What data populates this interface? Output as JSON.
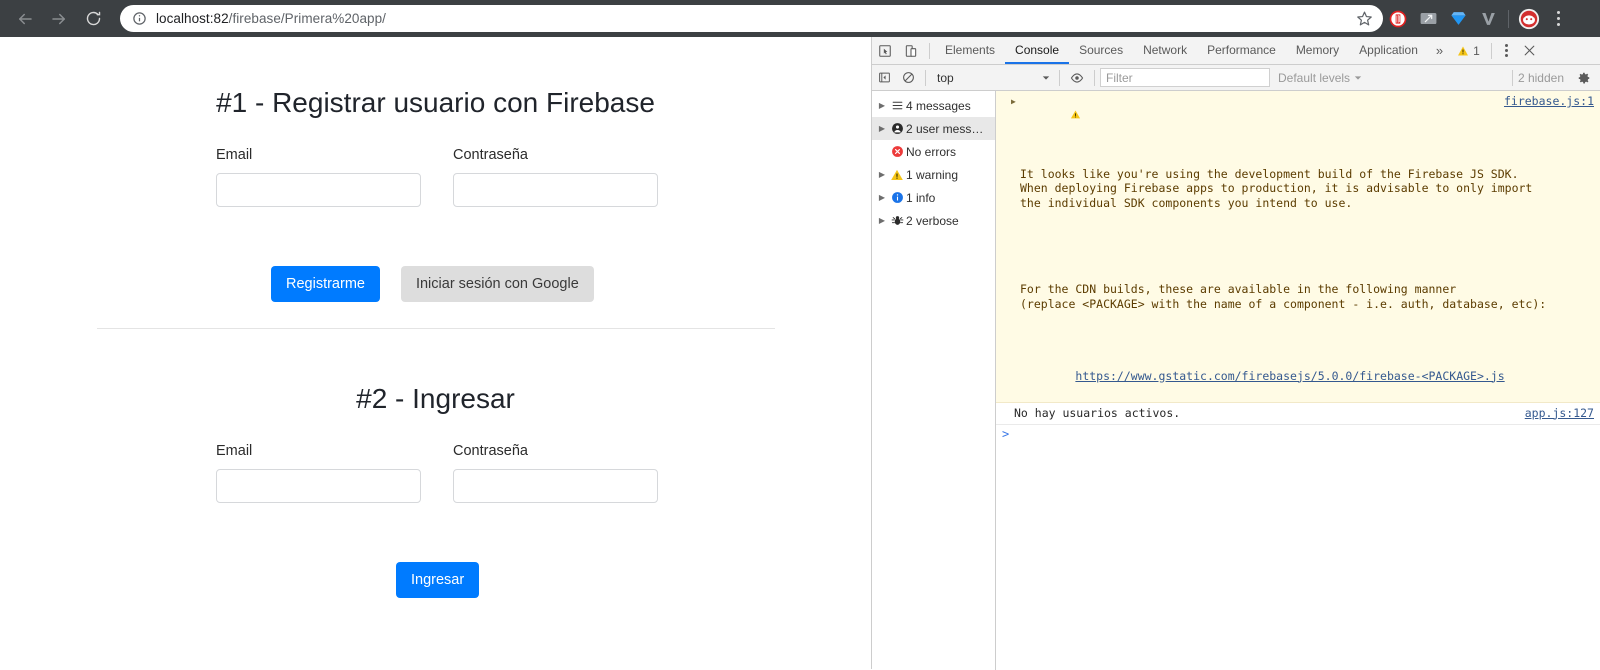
{
  "browser": {
    "back_icon": "arrow-left-icon",
    "forward_icon": "arrow-right-icon",
    "reload_icon": "reload-icon",
    "info_icon": "info-circle-icon",
    "url_host": "localhost:82",
    "url_path": "/firebase/Primera%20app/",
    "url_full": "localhost:82/firebase/Primera%20app/",
    "star_icon": "bookmark-star-icon",
    "extensions": [
      {
        "name": "adblock-extension-icon",
        "color": "#e02020"
      },
      {
        "name": "resize-extension-icon",
        "color": "#9aa0a6"
      },
      {
        "name": "diamond-extension-icon",
        "color": "#2196f3"
      },
      {
        "name": "v-extension-icon",
        "color": "#9aa0a6"
      }
    ],
    "profile_avatar": "profile-avatar-icon",
    "menu_icon": "three-dot-menu-icon"
  },
  "page": {
    "section1": {
      "heading": "#1 - Registrar usuario con Firebase",
      "email_label": "Email",
      "email_value": "",
      "password_label": "Contraseña",
      "password_value": "",
      "register_button": "Registrarme",
      "google_button": "Iniciar sesión con Google"
    },
    "section2": {
      "heading": "#2 - Ingresar",
      "email_label": "Email",
      "email_value": "",
      "password_label": "Contraseña",
      "password_value": "",
      "login_button": "Ingresar"
    },
    "colors": {
      "primary_button": "#007bff",
      "secondary_button": "#dddddd",
      "heading_text": "#20242b",
      "input_border": "#d6d8db"
    }
  },
  "devtools": {
    "inspect_icon": "inspect-element-icon",
    "device_icon": "device-toolbar-icon",
    "tabs": [
      {
        "label": "Elements",
        "active": false
      },
      {
        "label": "Console",
        "active": true
      },
      {
        "label": "Sources",
        "active": false
      },
      {
        "label": "Network",
        "active": false
      },
      {
        "label": "Performance",
        "active": false
      },
      {
        "label": "Memory",
        "active": false
      },
      {
        "label": "Application",
        "active": false
      }
    ],
    "overflow_label": "»",
    "warning_count": "1",
    "warning_icon": "warning-triangle-icon",
    "kebab_icon": "more-options-icon",
    "close_icon": "close-icon",
    "filterbar": {
      "sidebar_toggle_icon": "console-sidebar-toggle-icon",
      "clear_icon": "clear-console-icon",
      "context_value": "top",
      "eye_icon": "live-expression-eye-icon",
      "filter_placeholder": "Filter",
      "filter_value": "",
      "levels_value": "Default levels",
      "hidden_label": "2 hidden",
      "settings_icon": "settings-gear-icon"
    },
    "sidebar": [
      {
        "label": "4 messages",
        "icon": "list-icon",
        "arrow": true,
        "selected": false
      },
      {
        "label": "2 user mess…",
        "icon": "user-icon",
        "arrow": true,
        "selected": true
      },
      {
        "label": "No errors",
        "icon": "error-circle-icon",
        "arrow": false,
        "selected": false
      },
      {
        "label": "1 warning",
        "icon": "warning-triangle-icon",
        "arrow": true,
        "selected": false
      },
      {
        "label": "1 info",
        "icon": "info-circle-icon",
        "arrow": true,
        "selected": false
      },
      {
        "label": "2 verbose",
        "icon": "bug-icon",
        "arrow": true,
        "selected": false
      }
    ],
    "console": {
      "warning_message_part1": "It looks like you're using the development build of the Firebase JS SDK.\nWhen deploying Firebase apps to production, it is advisable to only import\nthe individual SDK components you intend to use.",
      "warning_message_part2": "For the CDN builds, these are available in the following manner\n(replace <PACKAGE> with the name of a component - i.e. auth, database, etc):",
      "warning_message_link": "https://www.gstatic.com/firebasejs/5.0.0/firebase-<PACKAGE>.js",
      "warning_source": "firebase.js:1",
      "log_message": "No hay usuarios activos.",
      "log_source": "app.js:127",
      "prompt_caret": ">"
    }
  }
}
